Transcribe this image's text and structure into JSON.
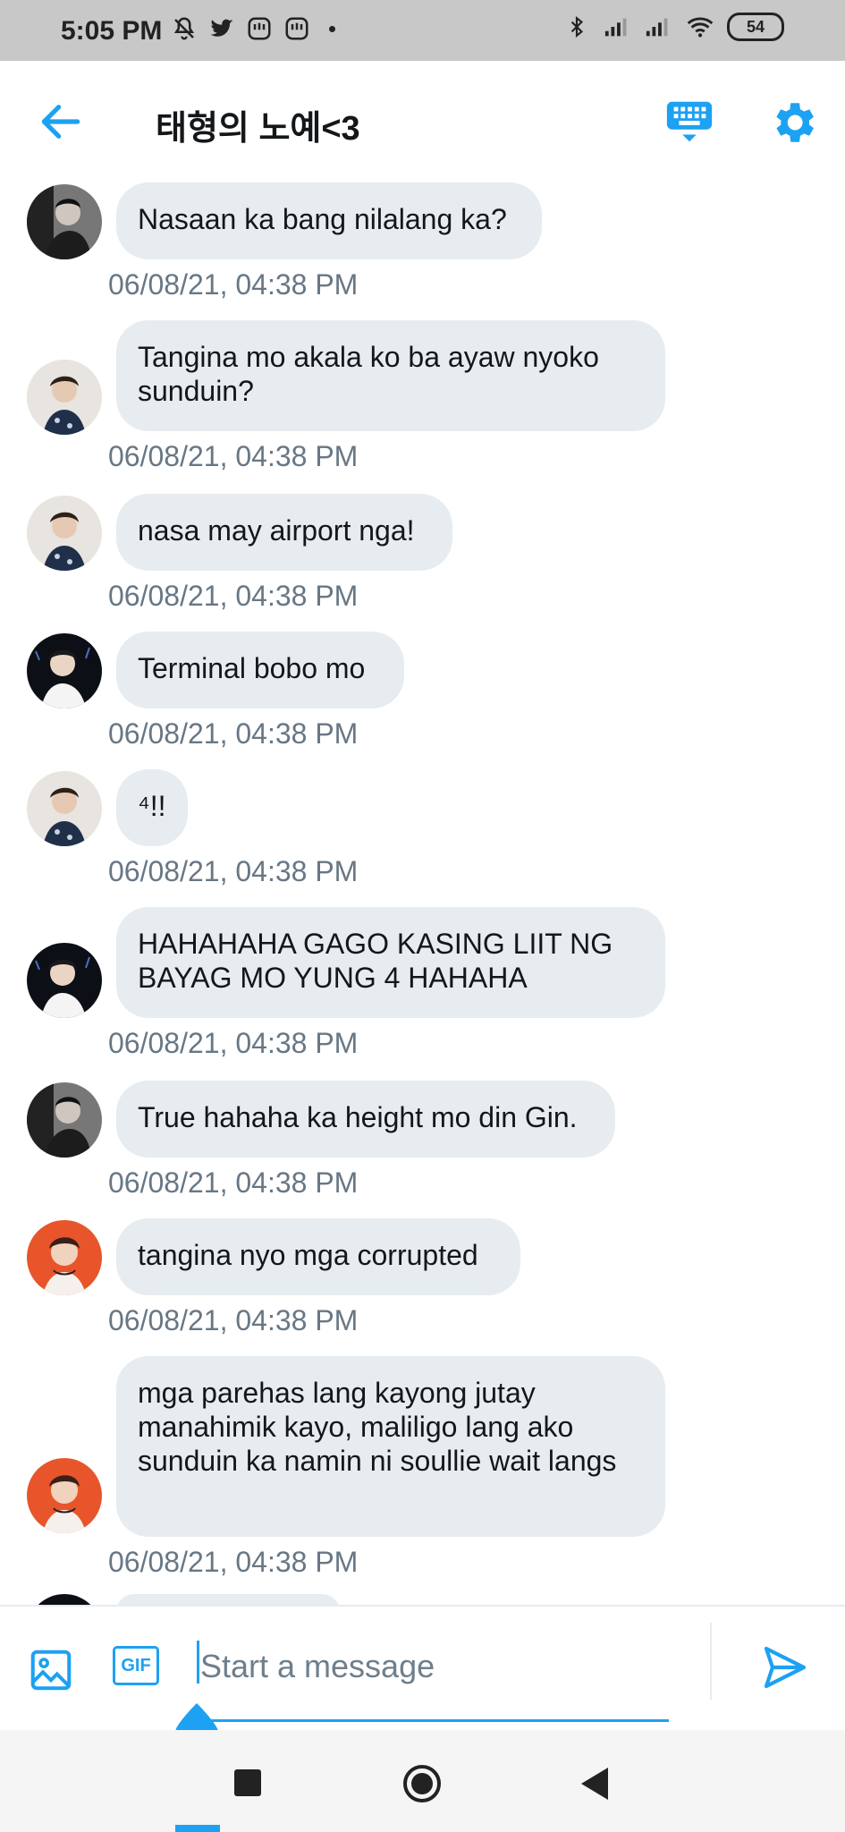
{
  "status_bar": {
    "time": "5:05 PM",
    "battery": "54",
    "left_icons": [
      "notifications-off-icon",
      "twitter-icon",
      "app-icon",
      "app-icon",
      "dot-icon"
    ],
    "right_icons": [
      "bluetooth-icon",
      "signal-icon",
      "signal-icon",
      "wifi-icon",
      "battery-icon"
    ]
  },
  "header": {
    "title": "태형의 노예<3",
    "back_icon": "arrow-left-icon",
    "keyboard_icon": "keyboard-icon",
    "settings_icon": "gear-icon"
  },
  "colors": {
    "accent": "#1da1f2",
    "bubble": "#e6ecf0",
    "timestamp": "#687785"
  },
  "messages": [
    {
      "text": "Nasaan ka bang nilalang ka?",
      "time": "06/08/21, 04:38 PM",
      "avatar": "avatar-gray"
    },
    {
      "text": "Tangina mo akala ko ba ayaw nyoko sunduin?",
      "time": "06/08/21, 04:38 PM",
      "avatar": "avatar-light"
    },
    {
      "text": "nasa may airport nga!",
      "time": "06/08/21, 04:38 PM",
      "avatar": "avatar-light"
    },
    {
      "text": "Terminal bobo mo",
      "time": "06/08/21, 04:38 PM",
      "avatar": "avatar-dark"
    },
    {
      "text": "⁴!!",
      "time": "06/08/21, 04:38 PM",
      "avatar": "avatar-light"
    },
    {
      "text": "HAHAHAHA GAGO KASING LIIT NG BAYAG MO YUNG 4 HAHAHA",
      "time": "06/08/21, 04:38 PM",
      "avatar": "avatar-dark"
    },
    {
      "text": "True hahaha ka height mo din Gin.",
      "time": "06/08/21, 04:38 PM",
      "avatar": "avatar-gray"
    },
    {
      "text": "tangina nyo mga corrupted",
      "time": "06/08/21, 04:38 PM",
      "avatar": "avatar-orange"
    },
    {
      "text": "mga parehas lang kayong jutay manahimik kayo, maliligo lang ako sunduin ka namin ni soullie wait langs",
      "time": "06/08/21, 04:38 PM",
      "avatar": "avatar-orange"
    }
  ],
  "composer": {
    "placeholder": "Start a message",
    "gif_label": "GIF",
    "media_icon": "image-icon",
    "send_icon": "send-icon"
  },
  "navbar": {
    "icons": [
      "recents-icon",
      "home-icon",
      "back-icon"
    ]
  }
}
